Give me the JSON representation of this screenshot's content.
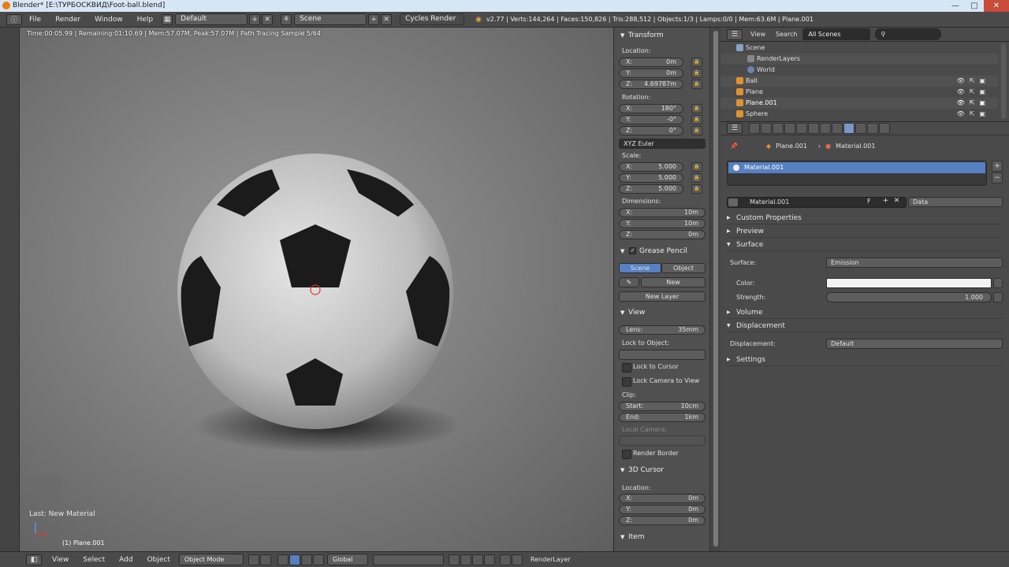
{
  "window": {
    "title": "Blender* [E:\\ТУРБОСКВИД\\Foot-ball.blend]",
    "minimize": "—",
    "maximize": "□",
    "close": "✕"
  },
  "infobar": {
    "menus": [
      "File",
      "Render",
      "Window",
      "Help"
    ],
    "layout": "Default",
    "scene": "Scene",
    "engine": "Cycles Render",
    "stats": "v2.77 | Verts:144,264 | Faces:150,826 | Tris:288,512 | Objects:1/3 | Lamps:0/0 | Mem:63.6M | Plane.001"
  },
  "viewport": {
    "render_status": "Time:00:05.99 | Remaining:01:10.69 | Mem:57.07M, Peak:57.07M | Path Tracing Sample 5/64",
    "last_op": "Last: New Material",
    "object_label": "(1) Plane.001"
  },
  "npanel": {
    "transform_title": "Transform",
    "location_label": "Location:",
    "location": {
      "x": "0m",
      "y": "0m",
      "z": "4.69787m"
    },
    "rotation_label": "Rotation:",
    "rotation": {
      "x": "180°",
      "y": "-0°",
      "z": "0°"
    },
    "rotation_mode": "XYZ Euler",
    "scale_label": "Scale:",
    "scale": {
      "x": "5.000",
      "y": "5.000",
      "z": "5.000"
    },
    "dimensions_label": "Dimensions:",
    "dimensions": {
      "x": "10m",
      "y": "10m",
      "z": "0m"
    },
    "grease_pencil": "Grease Pencil",
    "gp_scene": "Scene",
    "gp_object": "Object",
    "gp_new": "New",
    "gp_new_layer": "New Layer",
    "view_title": "View",
    "lens_label": "Lens:",
    "lens": "35mm",
    "lock_to_object": "Lock to Object:",
    "lock_cursor": "Lock to Cursor",
    "lock_camera": "Lock Camera to View",
    "clip_label": "Clip:",
    "clip_start_label": "Start:",
    "clip_start": "10cm",
    "clip_end_label": "End:",
    "clip_end": "1km",
    "local_camera": "Local Camera:",
    "render_border": "Render Border",
    "cursor_title": "3D Cursor",
    "cursor_location_label": "Location:",
    "cursor": {
      "x": "0m",
      "y": "0m",
      "z": "0m"
    },
    "item_title": "Item"
  },
  "outliner": {
    "view": "View",
    "search": "Search",
    "scope": "All Scenes",
    "items": [
      "Scene",
      "RenderLayers",
      "World",
      "Ball",
      "Plane",
      "Plane.001",
      "Sphere"
    ]
  },
  "properties": {
    "breadcrumb_object": "Plane.001",
    "breadcrumb_material": "Material.001",
    "slot": "Material.001",
    "material_name": "Material.001",
    "fake_user": "F",
    "link": "Data",
    "custom_props": "Custom Properties",
    "preview": "Preview",
    "surface_section": "Surface",
    "surface_label": "Surface:",
    "surface_value": "Emission",
    "color_label": "Color:",
    "strength_label": "Strength:",
    "strength_value": "1.000",
    "volume": "Volume",
    "displacement_section": "Displacement",
    "displacement_label": "Displacement:",
    "displacement_value": "Default",
    "settings": "Settings"
  },
  "bottombar": {
    "view": "View",
    "select": "Select",
    "add": "Add",
    "object": "Object",
    "mode": "Object Mode",
    "orientation": "Global",
    "render_layer": "RenderLayer"
  },
  "colors": {
    "accent": "#5680c2",
    "selection": "#5680c2",
    "window_close": "#c94b3a"
  }
}
